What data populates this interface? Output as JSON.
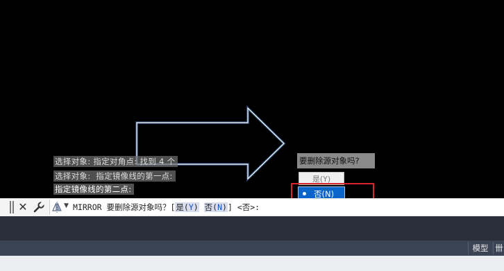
{
  "command_history": [
    "选择对象: 指定对角点: 找到 4 个",
    "选择对象:  指定镜像线的第一点:",
    "指定镜像线的第二点:"
  ],
  "popup": {
    "title": "要删除源对象吗?",
    "options": [
      {
        "label": "是(Y)",
        "selected": false
      },
      {
        "label": "否(N)",
        "selected": true
      }
    ]
  },
  "command_line": {
    "command": "MIRROR",
    "prompt": " 要删除源对象吗？[",
    "opt_yes_text": "是(",
    "opt_yes_key": "Y",
    "opt_yes_close": ")",
    "opt_sep": " ",
    "opt_no_text": "否(",
    "opt_no_key": "N",
    "opt_no_close": ")",
    "suffix": "] <否>:"
  },
  "status_bar": {
    "model_tab": "模型",
    "grid_label": "卌"
  },
  "icons": {
    "close": "close-icon",
    "wrench": "wrench-icon",
    "command": "mirror-command-icon",
    "dropdown": "dropdown-arrow-icon"
  },
  "colors": {
    "canvas_bg": "#000000",
    "arrow_stroke": "#ffffff",
    "selection_glow": "#5a8fe0",
    "highlight_box": "#d9262e",
    "selected_option_bg": "#0a64c9"
  }
}
